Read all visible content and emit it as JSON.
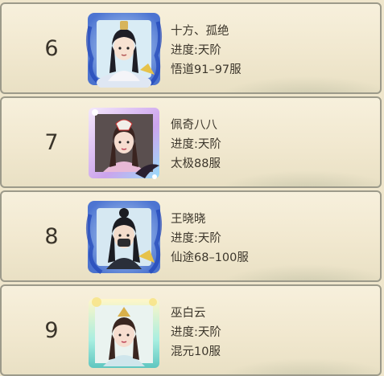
{
  "rows": [
    {
      "rank": "6",
      "name": "十方、孤绝",
      "progress": "进度:天阶",
      "server": "悟道91–97服",
      "frame": "blue-dragon-frame"
    },
    {
      "rank": "7",
      "name": "佩奇八八",
      "progress": "进度:天阶",
      "server": "太极88服",
      "frame": "purple-white-frame"
    },
    {
      "rank": "8",
      "name": "王晓晓",
      "progress": "进度:天阶",
      "server": "仙途68–100服",
      "frame": "blue-dragon-frame"
    },
    {
      "rank": "9",
      "name": "巫白云",
      "progress": "进度:天阶",
      "server": "混元10服",
      "frame": "gold-teal-frame"
    }
  ],
  "colors": {
    "row_bg": "#f3ebd3",
    "row_border": "#9c9a8a",
    "text": "#3d372c",
    "blue_frame": "#4a7fe0",
    "purple_frame": "#b58be8",
    "teal_frame": "#7fe0d0"
  }
}
